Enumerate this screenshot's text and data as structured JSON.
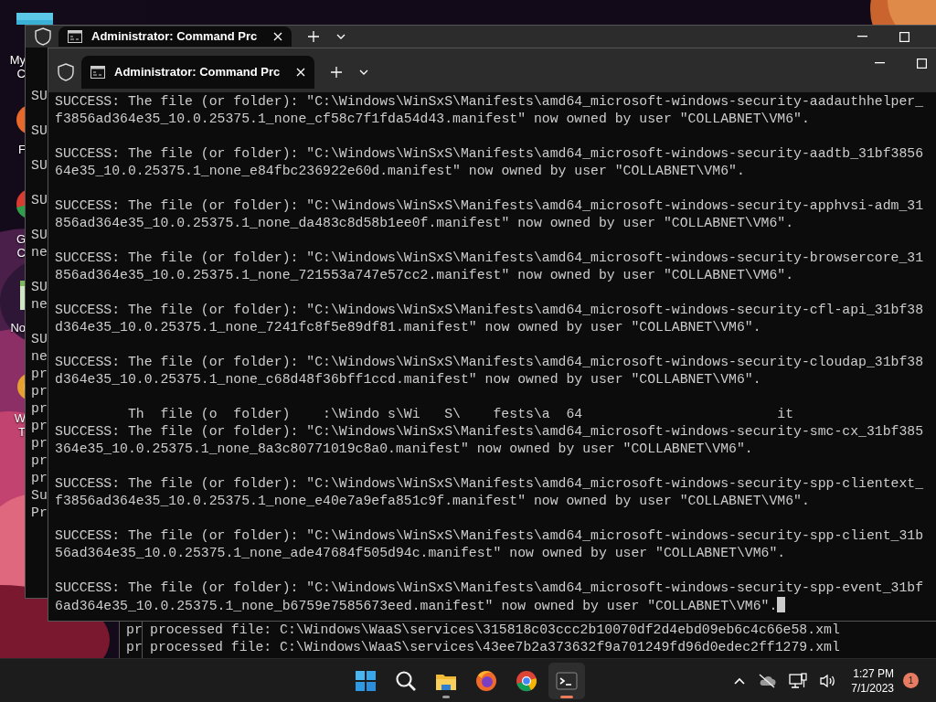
{
  "desktop_icons": [
    {
      "kind": "monitor",
      "label": [
        "My C"
      ]
    },
    {
      "kind": "firefox",
      "label": [
        "F"
      ]
    },
    {
      "kind": "chrome",
      "label": [
        "G",
        "C"
      ]
    },
    {
      "kind": "notepad",
      "label": [
        "No"
      ]
    },
    {
      "kind": "terminal",
      "label": [
        "W",
        "T"
      ]
    }
  ],
  "back_window": {
    "tab": {
      "title": "Administrator: Command Prc",
      "selected": true
    },
    "groups": [
      [
        "SU"
      ],
      [
        "SU"
      ],
      [
        "SU"
      ],
      [
        "SU"
      ],
      [
        "SU",
        "ne"
      ],
      [
        "SU",
        "ne"
      ],
      [
        "SU",
        "ne",
        "pr",
        "pr",
        "pr",
        "pr",
        "pr",
        "pr",
        "pr",
        "Su",
        "Pr"
      ]
    ]
  },
  "lower_window": {
    "lines": [
      "pr",
      "pr"
    ]
  },
  "processed_window": {
    "lines": [
      "processed file: C:\\Windows\\WaaS\\services\\315818c03ccc2b10070df2d4ebd09eb6c4c66e58.xml",
      "processed file: C:\\Windows\\WaaS\\services\\43ee7b2a373632f9a701249fd96d0edec2ff1279.xml"
    ]
  },
  "front_window": {
    "tab": {
      "title": "Administrator: Command Prc",
      "selected": true
    },
    "cursor": true,
    "output": [
      {
        "kind": "entry",
        "lines": [
          "SUCCESS: The file (or folder): \"C:\\Windows\\WinSxS\\Manifests\\amd64_microsoft-windows-security-aadauthhelper_",
          "f3856ad364e35_10.0.25375.1_none_cf58c7f1fda54d43.manifest\" now owned by user \"COLLABNET\\VM6\"."
        ]
      },
      {
        "kind": "entry",
        "lines": [
          "SUCCESS: The file (or folder): \"C:\\Windows\\WinSxS\\Manifests\\amd64_microsoft-windows-security-aadtb_31bf3856",
          "64e35_10.0.25375.1_none_e84fbc236922e60d.manifest\" now owned by user \"COLLABNET\\VM6\"."
        ]
      },
      {
        "kind": "entry",
        "lines": [
          "SUCCESS: The file (or folder): \"C:\\Windows\\WinSxS\\Manifests\\amd64_microsoft-windows-security-apphvsi-adm_31",
          "856ad364e35_10.0.25375.1_none_da483c8d58b1ee0f.manifest\" now owned by user \"COLLABNET\\VM6\"."
        ]
      },
      {
        "kind": "entry",
        "lines": [
          "SUCCESS: The file (or folder): \"C:\\Windows\\WinSxS\\Manifests\\amd64_microsoft-windows-security-browsercore_31",
          "856ad364e35_10.0.25375.1_none_721553a747e57cc2.manifest\" now owned by user \"COLLABNET\\VM6\"."
        ]
      },
      {
        "kind": "entry",
        "lines": [
          "SUCCESS: The file (or folder): \"C:\\Windows\\WinSxS\\Manifests\\amd64_microsoft-windows-security-cfl-api_31bf38",
          "d364e35_10.0.25375.1_none_7241fc8f5e89df81.manifest\" now owned by user \"COLLABNET\\VM6\"."
        ]
      },
      {
        "kind": "entry",
        "lines": [
          "SUCCESS: The file (or folder): \"C:\\Windows\\WinSxS\\Manifests\\amd64_microsoft-windows-security-cloudap_31bf38",
          "d364e35_10.0.25375.1_none_c68d48f36bff1ccd.manifest\" now owned by user \"COLLABNET\\VM6\"."
        ]
      },
      {
        "kind": "ghost",
        "text": "Th  file (o  folder)    :\\Windo s\\Wi   S\\    fests\\a  64                        it"
      },
      {
        "kind": "entry",
        "lines": [
          "SUCCESS: The file (or folder): \"C:\\Windows\\WinSxS\\Manifests\\amd64_microsoft-windows-security-smc-cx_31bf385",
          "364e35_10.0.25375.1_none_8a3c80771019c8a0.manifest\" now owned by user \"COLLABNET\\VM6\"."
        ]
      },
      {
        "kind": "entry",
        "lines": [
          "SUCCESS: The file (or folder): \"C:\\Windows\\WinSxS\\Manifests\\amd64_microsoft-windows-security-spp-clientext_",
          "f3856ad364e35_10.0.25375.1_none_e40e7a9efa851c9f.manifest\" now owned by user \"COLLABNET\\VM6\"."
        ]
      },
      {
        "kind": "entry",
        "lines": [
          "SUCCESS: The file (or folder): \"C:\\Windows\\WinSxS\\Manifests\\amd64_microsoft-windows-security-spp-client_31b",
          "56ad364e35_10.0.25375.1_none_ade47684f505d94c.manifest\" now owned by user \"COLLABNET\\VM6\"."
        ]
      },
      {
        "kind": "entry",
        "lines": [
          "SUCCESS: The file (or folder): \"C:\\Windows\\WinSxS\\Manifests\\amd64_microsoft-windows-security-spp-event_31bf",
          "6ad364e35_10.0.25375.1_none_b6759e7585673eed.manifest\" now owned by user \"COLLABNET\\VM6\"."
        ]
      }
    ]
  },
  "taskbar": {
    "apps": [
      {
        "kind": "start",
        "active": false,
        "running": false
      },
      {
        "kind": "search",
        "active": false,
        "running": false
      },
      {
        "kind": "explorer",
        "active": false,
        "running": true
      },
      {
        "kind": "firefox",
        "active": false,
        "running": false
      },
      {
        "kind": "chrome",
        "active": false,
        "running": false
      },
      {
        "kind": "terminal",
        "active": true,
        "running": true
      }
    ],
    "tray": [
      {
        "kind": "chevron"
      },
      {
        "kind": "cloud-off"
      },
      {
        "kind": "network"
      },
      {
        "kind": "volume"
      }
    ],
    "time": "1:27 PM",
    "date": "7/1/2023",
    "notifications": "1"
  }
}
